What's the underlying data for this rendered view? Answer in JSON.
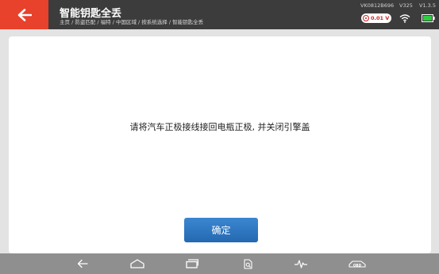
{
  "header": {
    "title": "智能钥匙全丢",
    "breadcrumb": "主页 / 防盗匹配 / 福特 / 中国区域 / 按系统选择 / 智能钥匙全丢",
    "serial": "VK0812B696",
    "model": "V325",
    "version": "V1.3.5",
    "voltage": "0.01 V",
    "icons": {
      "back": "back-arrow-icon",
      "voltage": "voltage-icon",
      "wifi": "wifi-icon",
      "battery": "battery-icon"
    },
    "colors": {
      "back_button": "#e8412c",
      "bar": "#3c3c3c",
      "voltage_text": "#cc2222",
      "battery": "#2ecc40"
    }
  },
  "dialog": {
    "message": "请将汽车正极接线接回电瓶正极, 并关闭引擎盖",
    "confirm_label": "确定",
    "colors": {
      "confirm_button": "#2b74c0"
    }
  },
  "navbar": {
    "icons": [
      "back-icon",
      "home-icon",
      "recent-apps-icon",
      "search-document-icon",
      "diagnostic-pulse-icon",
      "vehicle-obd-icon"
    ],
    "obd_label": "OBD"
  }
}
